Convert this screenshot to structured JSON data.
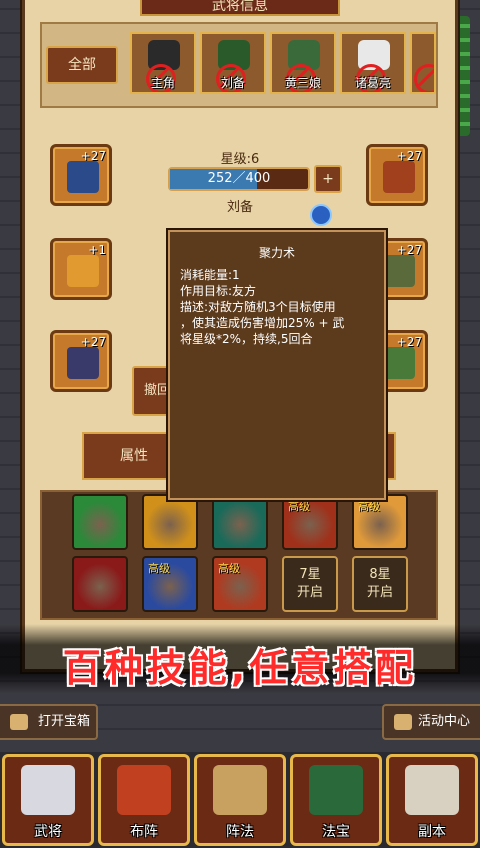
{
  "title": "武将信息",
  "tabs": {
    "all": "全部"
  },
  "heroes": [
    {
      "name": "主角",
      "color": "#2a2a2a"
    },
    {
      "name": "刘备",
      "color": "#2a5a2a"
    },
    {
      "name": "黄三娘",
      "color": "#3a6a3a"
    },
    {
      "name": "诸葛亮",
      "color": "#e8e8e8"
    },
    {
      "name": "",
      "color": "#a03020"
    }
  ],
  "equipment": {
    "helmet": {
      "level": "+27",
      "color": "#2a4a8a"
    },
    "armor": {
      "level": "+27",
      "color": "#a0401c"
    },
    "belt": {
      "level": "+1",
      "color": "#e09a30"
    },
    "boots_upper": {
      "level": "+27",
      "color": "#5a6a3a"
    },
    "weapon": {
      "level": "+27",
      "color": "#3a3a6a"
    },
    "boots": {
      "level": "+27",
      "color": "#4a7a3a"
    }
  },
  "hero_stats": {
    "star_label": "星级:6",
    "xp_text": "252／400",
    "xp_current": 252,
    "xp_max": 400,
    "plus": "+",
    "name": "刘备"
  },
  "buttons": {
    "retreat": "撤回",
    "attributes": "属性",
    "open_chest": "打开宝箱",
    "activity_center": "活动中心"
  },
  "tooltip": {
    "title": "聚力术",
    "cost": "消耗能量:1",
    "target": "作用目标:友方",
    "desc1": "描述:对敌方随机3个目标使用",
    "desc2": "，使其造成伤害增加25% + 武",
    "desc3": "将星级*2%，持续,5回合"
  },
  "skills": [
    {
      "tag": "",
      "color": "#2a8a3a"
    },
    {
      "tag": "",
      "color": "#d0901a"
    },
    {
      "tag": "",
      "color": "#1a6a5a"
    },
    {
      "tag": "高级",
      "color": "#a0301a"
    },
    {
      "tag": "高级",
      "color": "#e09a3a"
    },
    {
      "tag": "",
      "color": "#8a1a1a"
    },
    {
      "tag": "高级",
      "color": "#2a4aa0"
    },
    {
      "tag": "高级",
      "color": "#b03a20"
    }
  ],
  "locked_slots": [
    {
      "line1": "7星",
      "line2": "开启"
    },
    {
      "line1": "8星",
      "line2": "开启"
    }
  ],
  "banner": "百种技能,任意搭配",
  "nav": [
    {
      "label": "武将",
      "color": "#d8d8e0"
    },
    {
      "label": "布阵",
      "color": "#c04020"
    },
    {
      "label": "阵法",
      "color": "#c8a060"
    },
    {
      "label": "法宝",
      "color": "#2a6a3a"
    },
    {
      "label": "副本",
      "color": "#d8d0c0"
    }
  ]
}
